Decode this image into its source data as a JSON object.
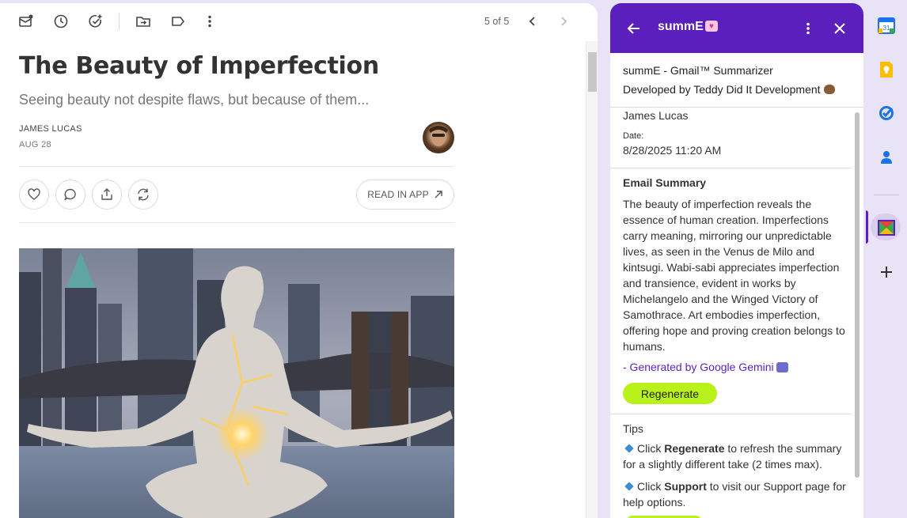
{
  "toolbar": {
    "pager": "5 of 5"
  },
  "article": {
    "title": "The Beauty of Imperfection",
    "subtitle": "Seeing beauty not despite flaws, but because of them...",
    "author": "JAMES LUCAS",
    "date": "AUG 28",
    "read_in_app": "READ IN APP"
  },
  "panel": {
    "title": "summE",
    "info_line1": "summE - Gmail™ Summarizer",
    "info_line2": "Developed by Teddy Did It Development",
    "sender": "James Lucas",
    "date_label": "Date:",
    "date_value": "8/28/2025 11:20 AM",
    "summary_heading": "Email Summary",
    "summary_text": "The beauty of imperfection reveals the essence of human creation. Imperfections carry meaning, mirroring our unpredictable lives, as seen in the Venus de Milo and kintsugi. Wabi-sabi appreciates imperfection and transience, evident in works by Michelangelo and the Winged Victory of Samothrace. Art embodies imperfection, offering hope and proving creation belongs to humans.",
    "generated_by": "- Generated by Google Gemini",
    "regenerate": "Regenerate",
    "tips_heading": "Tips",
    "tip1_prefix": "Click ",
    "tip1_bold": "Regenerate",
    "tip1_suffix": " to refresh the summary for a slightly different take (2 times max).",
    "tip2_prefix": "Click ",
    "tip2_bold": "Support",
    "tip2_suffix": " to visit our Support page for help options."
  },
  "colors": {
    "panel_header": "#5b1fbe",
    "regenerate_button": "#b9f21a",
    "rail_background": "#e9e3f7"
  },
  "rail": {
    "apps": [
      "calendar-icon",
      "keep-icon",
      "tasks-icon",
      "contacts-icon",
      "summe-icon",
      "add-icon"
    ]
  }
}
